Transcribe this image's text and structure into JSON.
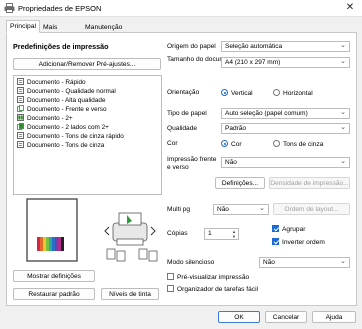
{
  "window": {
    "title": "Propriedades de EPSON",
    "close_glyph": "✕"
  },
  "tabs": [
    {
      "label": "Principal"
    },
    {
      "label": "Mais opções"
    },
    {
      "label": "Manutenção"
    }
  ],
  "presets": {
    "heading": "Predefinições de impressão",
    "add_remove_button": "Adicionar/Remover Pré-ajustes...",
    "items": [
      {
        "label": "Documento - Rápido",
        "icon": "document-icon"
      },
      {
        "label": "Documento - Qualidade normal",
        "icon": "document-icon"
      },
      {
        "label": "Documento - Alta qualidade",
        "icon": "document-icon"
      },
      {
        "label": "Documento - Frente e verso",
        "icon": "duplex-icon"
      },
      {
        "label": "Documento - 2+",
        "icon": "multipage-icon"
      },
      {
        "label": "Documento - 2 lados com 2+",
        "icon": "duplex-multipage-icon"
      },
      {
        "label": "Documento - Tons de cinza rápido",
        "icon": "document-icon"
      },
      {
        "label": "Documento - Tons de cinza",
        "icon": "document-icon"
      }
    ],
    "show_settings_button": "Mostrar definições",
    "restore_defaults_button": "Restaurar padrão",
    "ink_levels_button": "Níveis de tinta"
  },
  "settings": {
    "paper_source": {
      "label": "Origem do papel",
      "value": "Seleção automática"
    },
    "document_size": {
      "label": "Tamanho do documento",
      "value": "A4 (210 x 297 mm)"
    },
    "orientation": {
      "label": "Orientação",
      "options": [
        "Vertical",
        "Horizontal"
      ],
      "selected": "Vertical"
    },
    "paper_type": {
      "label": "Tipo de papel",
      "value": "Auto seleção (papel comum)"
    },
    "quality": {
      "label": "Qualidade",
      "value": "Padrão"
    },
    "color": {
      "label": "Cor",
      "options": [
        "Cor",
        "Tons de cinza"
      ],
      "selected": "Cor"
    },
    "duplex": {
      "label": "Impressão frente e verso",
      "value": "Não"
    },
    "settings_button": "Definições...",
    "print_density_button": "Densidade de impressão...",
    "multipage": {
      "label": "Multi pg",
      "value": "Não"
    },
    "layout_order_button": "Ordem de layout...",
    "copies": {
      "label": "Cópias",
      "value": "1"
    },
    "collate": {
      "label": "Agrupar",
      "checked": true
    },
    "reverse_order": {
      "label": "Inverter ordem",
      "checked": true
    },
    "quiet_mode": {
      "label": "Modo silencioso",
      "value": "Não"
    },
    "print_preview": {
      "label": "Pré-visualizar impressão",
      "checked": false
    },
    "job_arranger": {
      "label": "Organizador de tarefas fácil",
      "checked": false
    }
  },
  "footer": {
    "ok": "OK",
    "cancel": "Cancelar",
    "help": "Ajuda"
  },
  "colors": {
    "accent": "#1a6bd3",
    "preview_paper_border": "#333333"
  }
}
